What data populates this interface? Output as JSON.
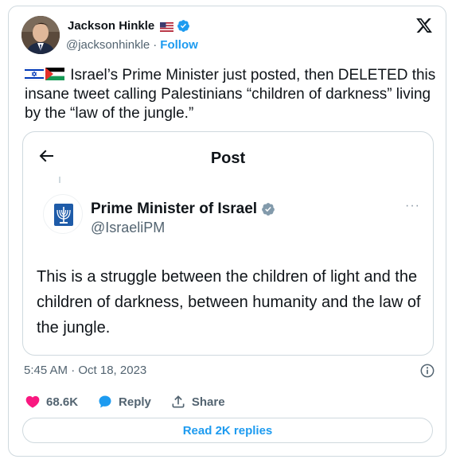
{
  "author": {
    "name": "Jackson Hinkle",
    "handle": "@jacksonhinkle",
    "separator": "·",
    "follow_label": "Follow"
  },
  "tweet": {
    "text": "Israel’s Prime Minister just posted, then DELETED this insane tweet calling Palestinians “children of darkness” living by the “law of the jungle.”"
  },
  "embedded": {
    "header_title": "Post",
    "author_name": "Prime Minister of Israel",
    "author_handle": "@IsraeliPM",
    "more": "···",
    "text": "This is a struggle between the children of light and the children of darkness, between humanity and the law of the jungle."
  },
  "timestamp": "5:45 AM · Oct 18, 2023",
  "actions": {
    "likes": "68.6K",
    "reply_label": "Reply",
    "share_label": "Share"
  },
  "read_replies_label": "Read 2K replies",
  "colors": {
    "accent": "#1d9bf0",
    "like": "#f91880",
    "text": "#0f1419",
    "muted": "#536471",
    "border": "#cfd9de"
  },
  "icons": [
    "x-logo-icon",
    "verified-badge-icon",
    "us-flag-icon",
    "israel-flag-icon",
    "palestine-flag-icon",
    "back-arrow-icon",
    "more-icon",
    "info-icon",
    "heart-icon",
    "reply-bubble-icon",
    "share-icon"
  ]
}
